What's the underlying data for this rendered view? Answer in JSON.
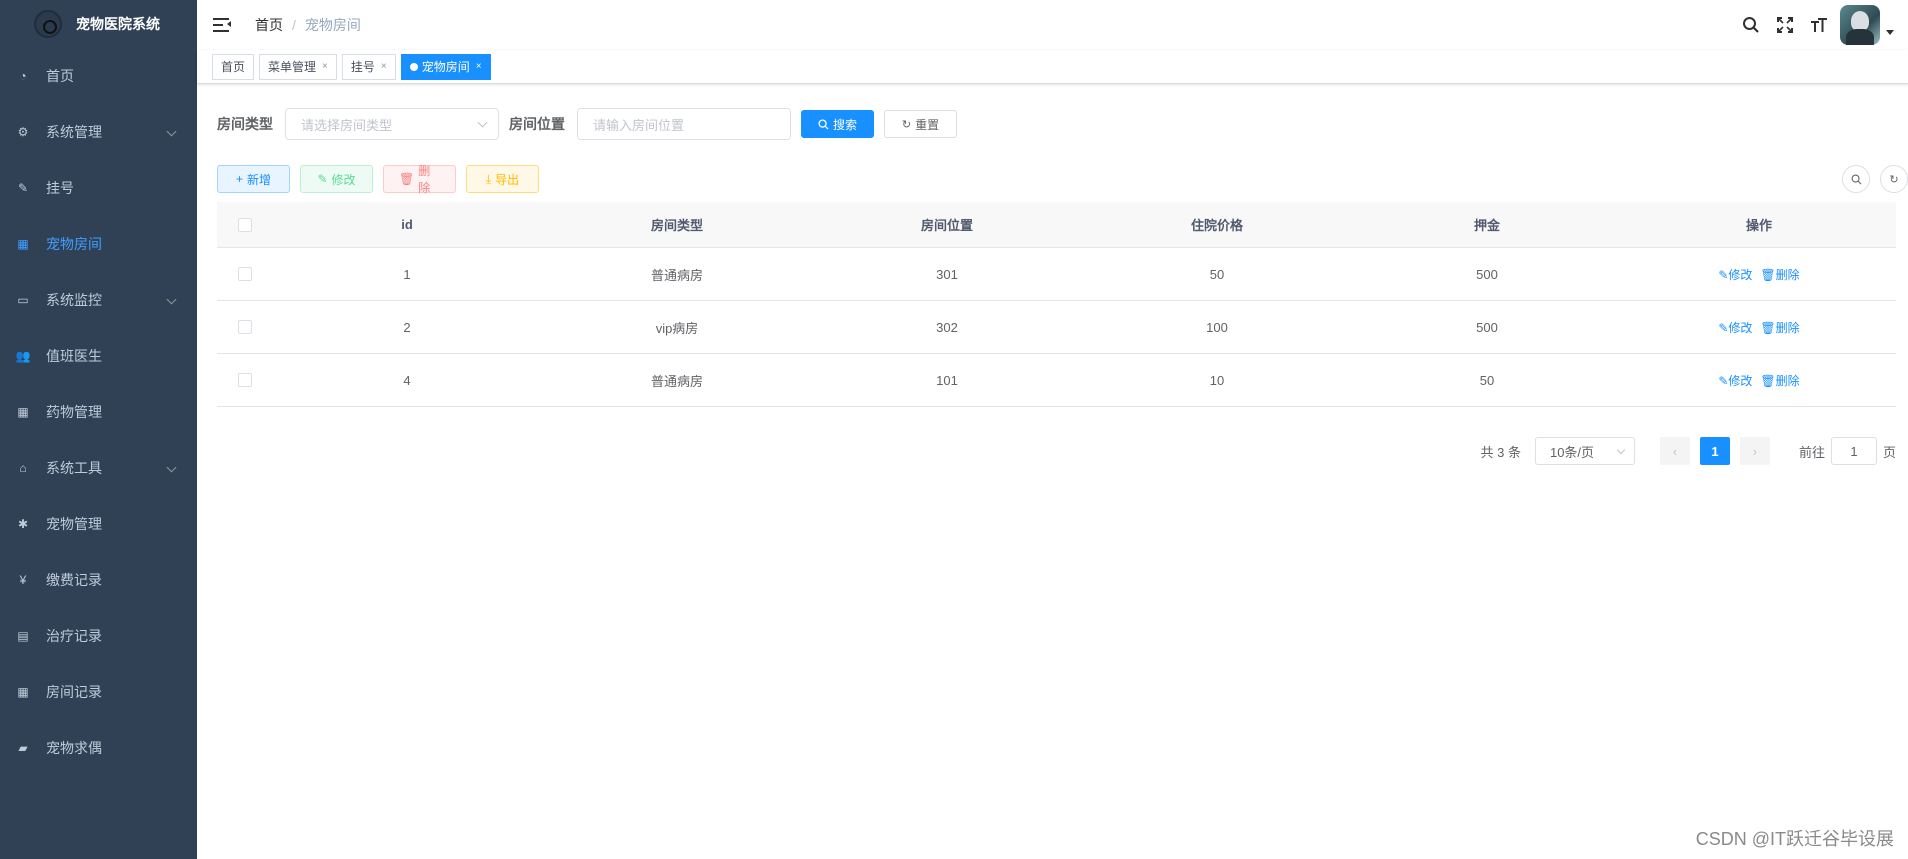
{
  "app": {
    "title": "宠物医院系统"
  },
  "sidebar": {
    "items": [
      {
        "label": "首页",
        "icon": "dashboard-icon",
        "glyph": "◔",
        "has_arrow": false,
        "active": false
      },
      {
        "label": "系统管理",
        "icon": "gear-icon",
        "glyph": "⚙",
        "has_arrow": true,
        "active": false
      },
      {
        "label": "挂号",
        "icon": "edit-icon",
        "glyph": "✎",
        "has_arrow": false,
        "active": false
      },
      {
        "label": "宠物房间",
        "icon": "table-icon",
        "glyph": "▦",
        "has_arrow": false,
        "active": true
      },
      {
        "label": "系统监控",
        "icon": "monitor-icon",
        "glyph": "▭",
        "has_arrow": true,
        "active": false
      },
      {
        "label": "值班医生",
        "icon": "peoples-icon",
        "glyph": "👥",
        "has_arrow": false,
        "active": false
      },
      {
        "label": "药物管理",
        "icon": "grid-icon",
        "glyph": "▦",
        "has_arrow": false,
        "active": false
      },
      {
        "label": "系统工具",
        "icon": "toolbox-icon",
        "glyph": "⌂",
        "has_arrow": true,
        "active": false
      },
      {
        "label": "宠物管理",
        "icon": "bug-icon",
        "glyph": "✱",
        "has_arrow": false,
        "active": false
      },
      {
        "label": "缴费记录",
        "icon": "yen-icon",
        "glyph": "¥",
        "has_arrow": false,
        "active": false
      },
      {
        "label": "治疗记录",
        "icon": "document-icon",
        "glyph": "▤",
        "has_arrow": false,
        "active": false
      },
      {
        "label": "房间记录",
        "icon": "list-icon",
        "glyph": "▦",
        "has_arrow": false,
        "active": false
      },
      {
        "label": "宠物求偶",
        "icon": "message-icon",
        "glyph": "▰",
        "has_arrow": false,
        "active": false
      }
    ]
  },
  "breadcrumb": {
    "home": "首页",
    "sep": "/",
    "current": "宠物房间"
  },
  "tags": [
    {
      "label": "首页",
      "closable": false,
      "active": false
    },
    {
      "label": "菜单管理",
      "closable": true,
      "active": false
    },
    {
      "label": "挂号",
      "closable": true,
      "active": false
    },
    {
      "label": "宠物房间",
      "closable": true,
      "active": true
    }
  ],
  "search": {
    "type_label": "房间类型",
    "type_placeholder": "请选择房间类型",
    "pos_label": "房间位置",
    "pos_placeholder": "请输入房间位置",
    "search_btn": "搜索",
    "reset_btn": "重置"
  },
  "toolbar": {
    "add": "新增",
    "edit": "修改",
    "delete": "删除",
    "export": "导出"
  },
  "table": {
    "columns": [
      "id",
      "房间类型",
      "房间位置",
      "住院价格",
      "押金",
      "操作"
    ],
    "rows": [
      {
        "id": "1",
        "type": "普通病房",
        "pos": "301",
        "price": "50",
        "deposit": "500"
      },
      {
        "id": "2",
        "type": "vip病房",
        "pos": "302",
        "price": "100",
        "deposit": "500"
      },
      {
        "id": "4",
        "type": "普通病房",
        "pos": "101",
        "price": "10",
        "deposit": "50"
      }
    ],
    "op_edit": "修改",
    "op_delete": "删除"
  },
  "pagination": {
    "total": "共 3 条",
    "page_size": "10条/页",
    "current_page": "1",
    "goto_prefix": "前往",
    "goto_value": "1",
    "goto_suffix": "页"
  },
  "watermark": "CSDN @IT跃迁谷毕设展",
  "colors": {
    "sidebar_bg": "#304156",
    "accent": "#1890ff",
    "menu_text": "#bfcbd9"
  }
}
